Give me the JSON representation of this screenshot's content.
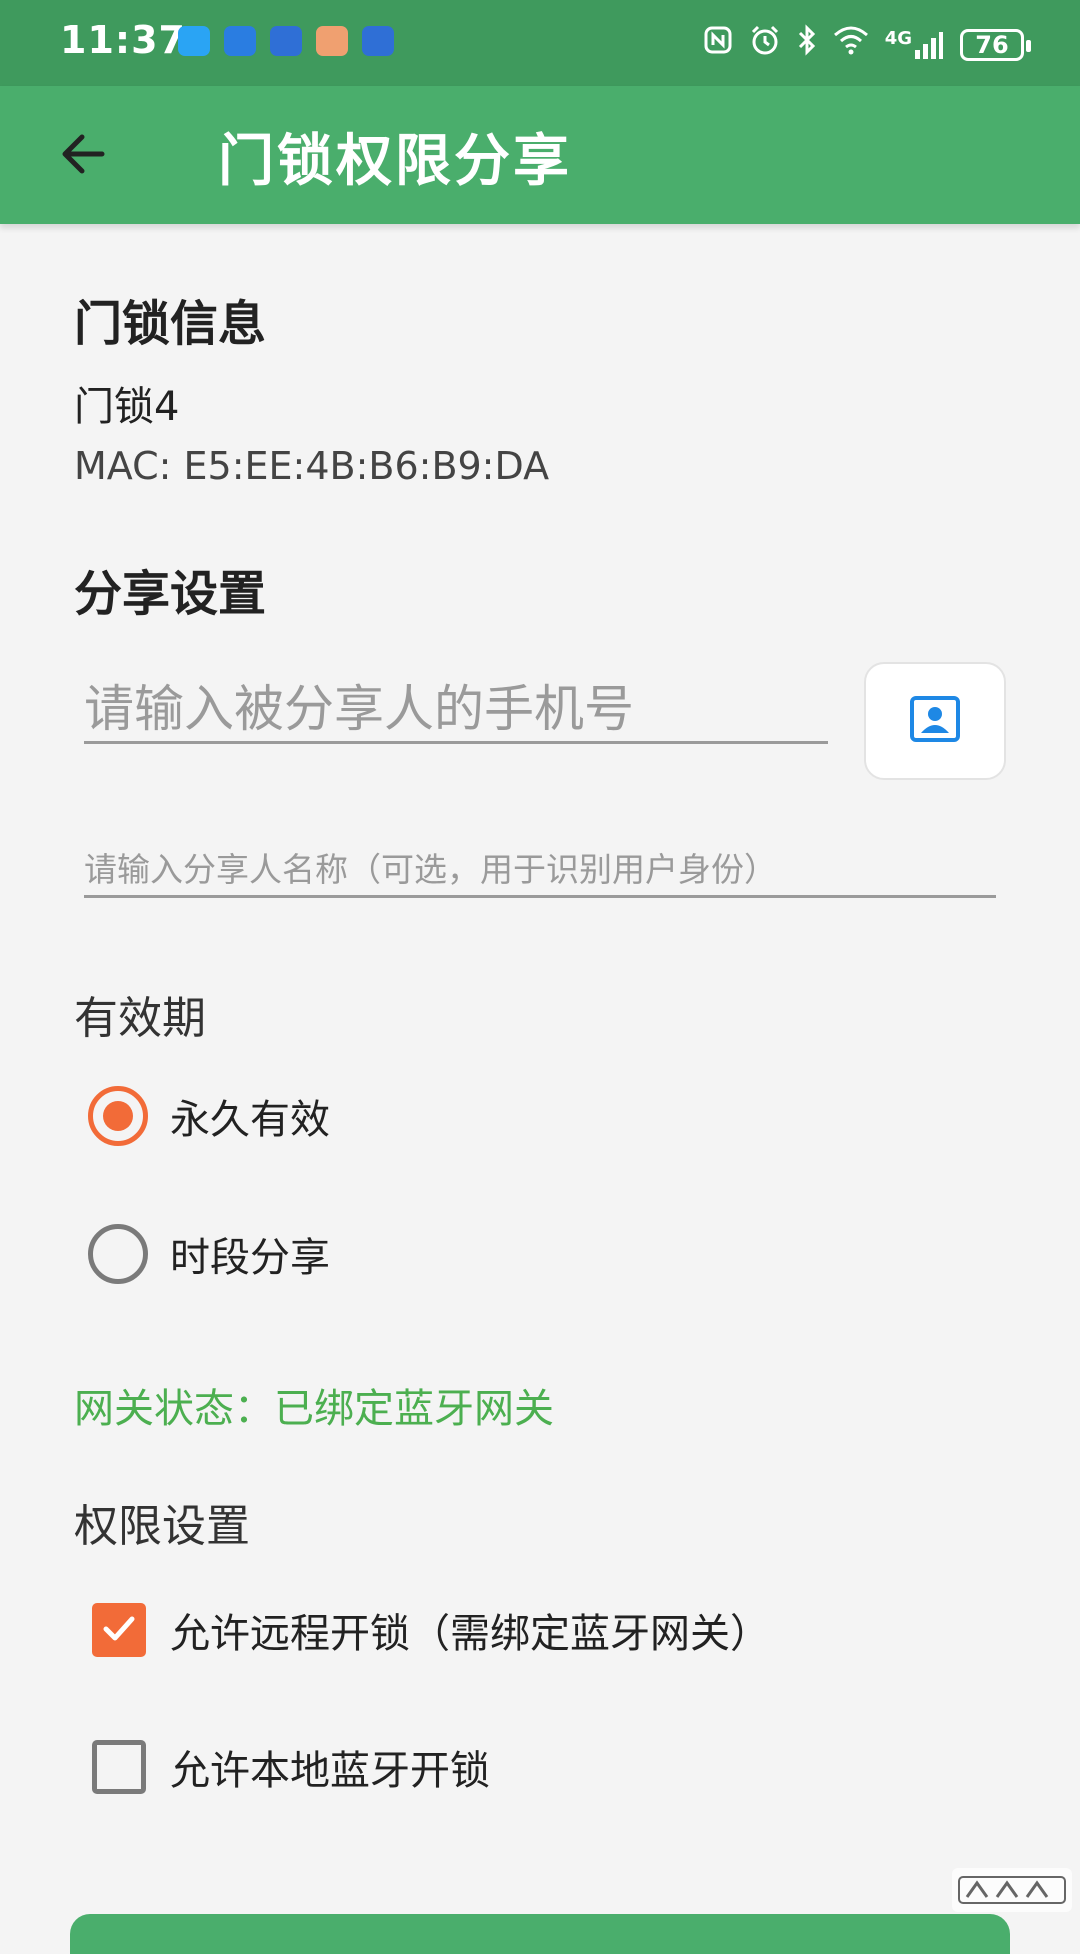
{
  "status_bar": {
    "time": "11:37",
    "network": "4G",
    "battery": "76",
    "notification_icons": [
      "message-icon",
      "app-notify-icon",
      "app-notify-icon",
      "chat-icon",
      "app-notify-icon"
    ],
    "system_icons": [
      "nfc-icon",
      "alarm-icon",
      "bluetooth-icon",
      "wifi-icon",
      "signal-icon"
    ]
  },
  "app_bar": {
    "title": "门锁权限分享"
  },
  "lock_info": {
    "section_title": "门锁信息",
    "name": "门锁4",
    "mac": "MAC: E5:EE:4B:B6:B9:DA"
  },
  "share_settings": {
    "section_title": "分享设置",
    "phone_placeholder": "请输入被分享人的手机号",
    "name_placeholder": "请输入分享人名称（可选，用于识别用户身份）"
  },
  "validity": {
    "label": "有效期",
    "options": [
      {
        "label": "永久有效",
        "selected": true
      },
      {
        "label": "时段分享",
        "selected": false
      }
    ]
  },
  "gateway_status": "网关状态：已绑定蓝牙网关",
  "permissions": {
    "label": "权限设置",
    "options": [
      {
        "label": "允许远程开锁（需绑定蓝牙网关）",
        "checked": true
      },
      {
        "label": "允许本地蓝牙开锁",
        "checked": false
      }
    ]
  },
  "colors": {
    "status_bar": "#3f9a5d",
    "app_bar": "#4aae6c",
    "accent": "#f26b38",
    "gateway_text": "#4caf50",
    "contact_icon": "#1e88e5"
  }
}
